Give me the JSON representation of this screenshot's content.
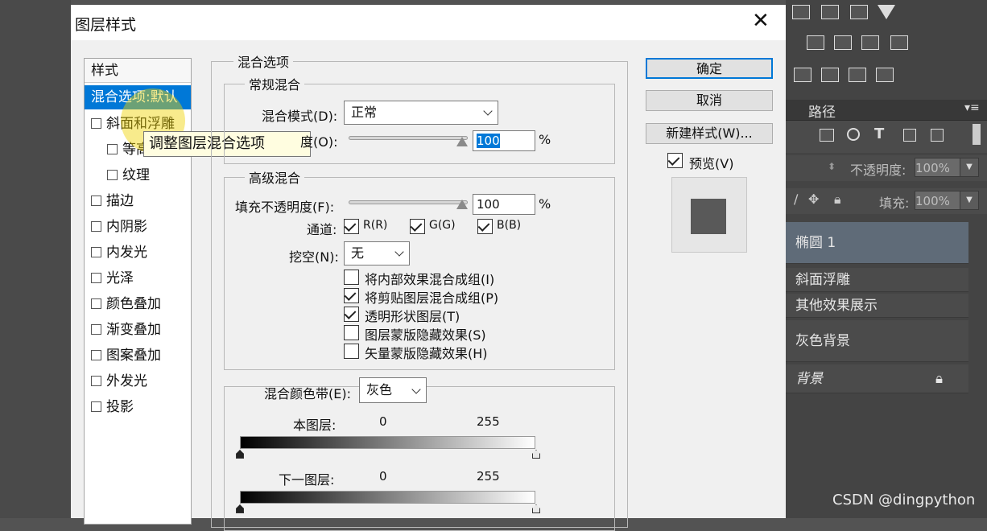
{
  "dialog": {
    "title": "图层样式"
  },
  "styles_list": {
    "header": "样式",
    "items": [
      {
        "label": "混合选项:默认",
        "checkbox": false,
        "selected": true,
        "indent": false
      },
      {
        "label": "斜面和浮雕",
        "checkbox": true,
        "indent": false
      },
      {
        "label": "等高",
        "checkbox": true,
        "indent": true
      },
      {
        "label": "纹理",
        "checkbox": true,
        "indent": true
      },
      {
        "label": "描边",
        "checkbox": true,
        "indent": false
      },
      {
        "label": "内阴影",
        "checkbox": true,
        "indent": false
      },
      {
        "label": "内发光",
        "checkbox": true,
        "indent": false
      },
      {
        "label": "光泽",
        "checkbox": true,
        "indent": false
      },
      {
        "label": "颜色叠加",
        "checkbox": true,
        "indent": false
      },
      {
        "label": "渐变叠加",
        "checkbox": true,
        "indent": false
      },
      {
        "label": "图案叠加",
        "checkbox": true,
        "indent": false
      },
      {
        "label": "外发光",
        "checkbox": true,
        "indent": false
      },
      {
        "label": "投影",
        "checkbox": true,
        "indent": false
      }
    ],
    "tooltip": "调整图层混合选项"
  },
  "blend_options": {
    "title": "混合选项",
    "general": {
      "title": "常规混合",
      "mode_label": "混合模式(D):",
      "mode_value": "正常",
      "opacity_label": "度(O):",
      "opacity_value": "100",
      "opacity_unit": "%"
    },
    "advanced": {
      "title": "高级混合",
      "fill_label": "填充不透明度(F):",
      "fill_value": "100",
      "fill_unit": "%",
      "channels_label": "通道:",
      "channel_r": "R(R)",
      "channel_g": "G(G)",
      "channel_b": "B(B)",
      "knockout_label": "挖空(N):",
      "knockout_value": "无",
      "options": [
        {
          "label": "将内部效果混合成组(I)",
          "checked": false
        },
        {
          "label": "将剪贴图层混合成组(P)",
          "checked": true
        },
        {
          "label": "透明形状图层(T)",
          "checked": true
        },
        {
          "label": "图层蒙版隐藏效果(S)",
          "checked": false
        },
        {
          "label": "矢量蒙版隐藏效果(H)",
          "checked": false
        }
      ]
    },
    "blend_if": {
      "label": "混合颜色带(E):",
      "value": "灰色",
      "this_layer_label": "本图层:",
      "this_layer_min": "0",
      "this_layer_max": "255",
      "under_layer_label": "下一图层:",
      "under_layer_min": "0",
      "under_layer_max": "255"
    }
  },
  "buttons": {
    "ok": "确定",
    "cancel": "取消",
    "new_style": "新建样式(W)...",
    "preview": "预览(V)"
  },
  "layers_panel": {
    "tab": "路径",
    "opacity_label": "不透明度:",
    "opacity_value": "100%",
    "fill_label": "填充:",
    "fill_value": "100%",
    "layers": [
      {
        "name": "椭圆 1",
        "selected": true
      },
      {
        "name": "斜面浮雕"
      },
      {
        "name": "其他效果展示"
      },
      {
        "name": "灰色背景"
      },
      {
        "name": "背景",
        "locked": true
      }
    ]
  },
  "watermark": "CSDN @dingpython",
  "colors": {
    "selection": "#0078d7",
    "ps_bg": "#535353"
  }
}
